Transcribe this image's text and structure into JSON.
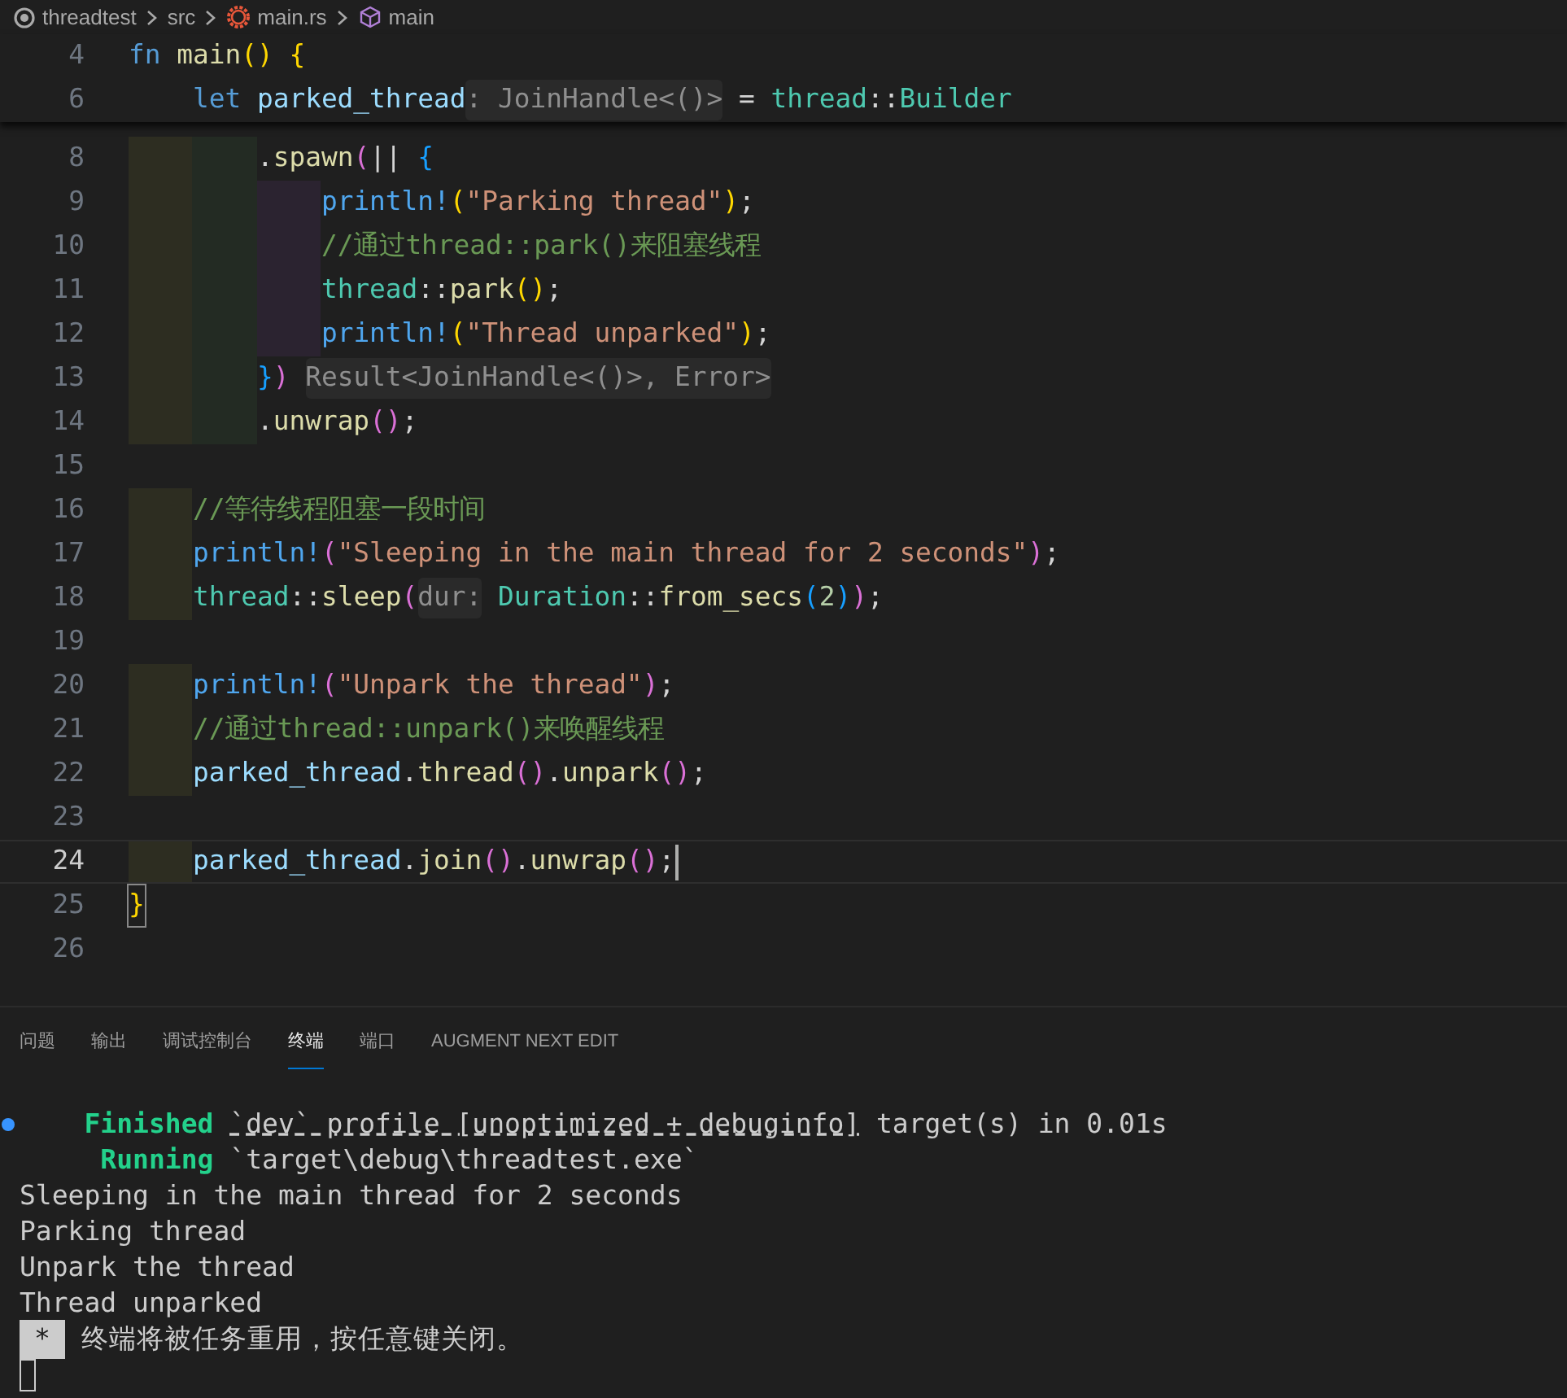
{
  "breadcrumb": [
    {
      "kind": "folder",
      "label": "threadtest"
    },
    {
      "kind": "plain",
      "label": "src"
    },
    {
      "kind": "rust",
      "label": "main.rs"
    },
    {
      "kind": "symbol",
      "label": "main"
    }
  ],
  "sticky_lines": [
    {
      "number": "4",
      "current": false,
      "tokens": [
        {
          "kind": "kw",
          "text": "fn "
        },
        {
          "kind": "fn",
          "text": "main"
        },
        {
          "kind": "gold",
          "text": "() {"
        }
      ]
    },
    {
      "number": "6",
      "current": false,
      "tokens": [
        {
          "kind": "kw",
          "text": "    let "
        },
        {
          "kind": "var",
          "text": "parked_thread"
        },
        {
          "kind": "hint",
          "text": ": JoinHandle<()>"
        },
        {
          "kind": "plain",
          "text": " = "
        },
        {
          "kind": "type",
          "text": "thread"
        },
        {
          "kind": "plain",
          "text": "::"
        },
        {
          "kind": "type",
          "text": "Builder"
        }
      ]
    }
  ],
  "code": [
    {
      "number": "8",
      "current": false,
      "tokens": [
        {
          "kind": "plain",
          "text": "        ."
        },
        {
          "kind": "fn",
          "text": "spawn"
        },
        {
          "kind": "purple",
          "text": "("
        },
        {
          "kind": "plain",
          "text": "|| "
        },
        {
          "kind": "blue",
          "text": "{"
        }
      ]
    },
    {
      "number": "9",
      "current": false,
      "tokens": [
        {
          "kind": "macro",
          "text": "            println!"
        },
        {
          "kind": "gold",
          "text": "("
        },
        {
          "kind": "str",
          "text": "\"Parking thread\""
        },
        {
          "kind": "gold",
          "text": ")"
        },
        {
          "kind": "plain",
          "text": ";"
        }
      ]
    },
    {
      "number": "10",
      "current": false,
      "tokens": [
        {
          "kind": "comment",
          "text": "            //通过thread::park()来阻塞线程"
        }
      ]
    },
    {
      "number": "11",
      "current": false,
      "tokens": [
        {
          "kind": "type",
          "text": "            thread"
        },
        {
          "kind": "plain",
          "text": "::"
        },
        {
          "kind": "fn",
          "text": "park"
        },
        {
          "kind": "gold",
          "text": "()"
        },
        {
          "kind": "plain",
          "text": ";"
        }
      ]
    },
    {
      "number": "12",
      "current": false,
      "tokens": [
        {
          "kind": "macro",
          "text": "            println!"
        },
        {
          "kind": "gold",
          "text": "("
        },
        {
          "kind": "str",
          "text": "\"Thread unparked\""
        },
        {
          "kind": "gold",
          "text": ")"
        },
        {
          "kind": "plain",
          "text": ";"
        }
      ]
    },
    {
      "number": "13",
      "current": false,
      "tokens": [
        {
          "kind": "blue",
          "text": "        }"
        },
        {
          "kind": "purple",
          "text": ") "
        },
        {
          "kind": "hint",
          "text": "Result<JoinHandle<()>, Error>"
        }
      ]
    },
    {
      "number": "14",
      "current": false,
      "tokens": [
        {
          "kind": "plain",
          "text": "        ."
        },
        {
          "kind": "fn",
          "text": "unwrap"
        },
        {
          "kind": "purple",
          "text": "()"
        },
        {
          "kind": "plain",
          "text": ";"
        }
      ]
    },
    {
      "number": "15",
      "current": false
    },
    {
      "number": "16",
      "current": false,
      "tokens": [
        {
          "kind": "comment",
          "text": "    //等待线程阻塞一段时间"
        }
      ]
    },
    {
      "number": "17",
      "current": false,
      "tokens": [
        {
          "kind": "macro",
          "text": "    println!"
        },
        {
          "kind": "purple",
          "text": "("
        },
        {
          "kind": "str",
          "text": "\"Sleeping in the main thread for 2 seconds\""
        },
        {
          "kind": "purple",
          "text": ")"
        },
        {
          "kind": "plain",
          "text": ";"
        }
      ]
    },
    {
      "number": "18",
      "current": false,
      "tokens": [
        {
          "kind": "type",
          "text": "    thread"
        },
        {
          "kind": "plain",
          "text": "::"
        },
        {
          "kind": "fn",
          "text": "sleep"
        },
        {
          "kind": "purple",
          "text": "("
        },
        {
          "kind": "hint",
          "text": "dur:"
        },
        {
          "kind": "type",
          "text": " Duration"
        },
        {
          "kind": "plain",
          "text": "::"
        },
        {
          "kind": "fn",
          "text": "from_secs"
        },
        {
          "kind": "blue",
          "text": "("
        },
        {
          "kind": "num",
          "text": "2"
        },
        {
          "kind": "blue",
          "text": ")"
        },
        {
          "kind": "purple",
          "text": ")"
        },
        {
          "kind": "plain",
          "text": ";"
        }
      ]
    },
    {
      "number": "19",
      "current": false
    },
    {
      "number": "20",
      "current": false,
      "tokens": [
        {
          "kind": "macro",
          "text": "    println!"
        },
        {
          "kind": "purple",
          "text": "("
        },
        {
          "kind": "str",
          "text": "\"Unpark the thread\""
        },
        {
          "kind": "purple",
          "text": ")"
        },
        {
          "kind": "plain",
          "text": ";"
        }
      ]
    },
    {
      "number": "21",
      "current": false,
      "tokens": [
        {
          "kind": "comment",
          "text": "    //通过thread::unpark()来唤醒线程"
        }
      ]
    },
    {
      "number": "22",
      "current": false,
      "tokens": [
        {
          "kind": "var",
          "text": "    parked_thread"
        },
        {
          "kind": "plain",
          "text": "."
        },
        {
          "kind": "fn",
          "text": "thread"
        },
        {
          "kind": "purple",
          "text": "()"
        },
        {
          "kind": "plain",
          "text": "."
        },
        {
          "kind": "fn",
          "text": "unpark"
        },
        {
          "kind": "purple",
          "text": "()"
        },
        {
          "kind": "plain",
          "text": ";"
        }
      ]
    },
    {
      "number": "23",
      "current": false
    },
    {
      "number": "24",
      "current": true,
      "tokens": [
        {
          "kind": "var",
          "text": "    parked_thread"
        },
        {
          "kind": "plain",
          "text": "."
        },
        {
          "kind": "fn",
          "text": "join"
        },
        {
          "kind": "purple",
          "text": "()"
        },
        {
          "kind": "plain",
          "text": "."
        },
        {
          "kind": "fn",
          "text": "unwrap"
        },
        {
          "kind": "purple",
          "text": "()"
        },
        {
          "kind": "plain",
          "text": ";"
        }
      ]
    },
    {
      "number": "25",
      "current": false,
      "tokens": [
        {
          "kind": "match",
          "text": "}"
        }
      ]
    },
    {
      "number": "26",
      "current": false
    }
  ],
  "panel_tabs": [
    {
      "label": "问题",
      "selected": false
    },
    {
      "label": "输出",
      "selected": false
    },
    {
      "label": "调试控制台",
      "selected": false
    },
    {
      "label": "终端",
      "selected": true
    },
    {
      "label": "端口",
      "selected": false
    },
    {
      "label": "AUGMENT NEXT EDIT",
      "selected": false
    }
  ],
  "terminal": [
    {
      "marker": true,
      "parts": [
        {
          "kind": "status",
          "text": "    Finished "
        },
        {
          "kind": "dashed",
          "text": "`dev` profile [unoptimized + debuginfo]"
        },
        {
          "kind": "plain",
          "text": " target(s) in 0.01s"
        }
      ]
    },
    {
      "marker": false,
      "parts": [
        {
          "kind": "status",
          "text": "     Running"
        },
        {
          "kind": "plain",
          "text": " `target\\debug\\threadtest.exe`"
        }
      ]
    },
    {
      "marker": false,
      "parts": [
        {
          "kind": "plain",
          "text": "Sleeping in the main thread for 2 seconds"
        }
      ]
    },
    {
      "marker": false,
      "parts": [
        {
          "kind": "plain",
          "text": "Parking thread"
        }
      ]
    },
    {
      "marker": false,
      "parts": [
        {
          "kind": "plain",
          "text": "Unpark the thread"
        }
      ]
    },
    {
      "marker": false,
      "parts": [
        {
          "kind": "plain",
          "text": "Thread unparked"
        }
      ]
    },
    {
      "marker": false,
      "parts": [
        {
          "kind": "badge",
          "text": "*"
        },
        {
          "kind": "plain",
          "text": "终端将被任务重用，按任意键关闭。"
        }
      ]
    }
  ]
}
